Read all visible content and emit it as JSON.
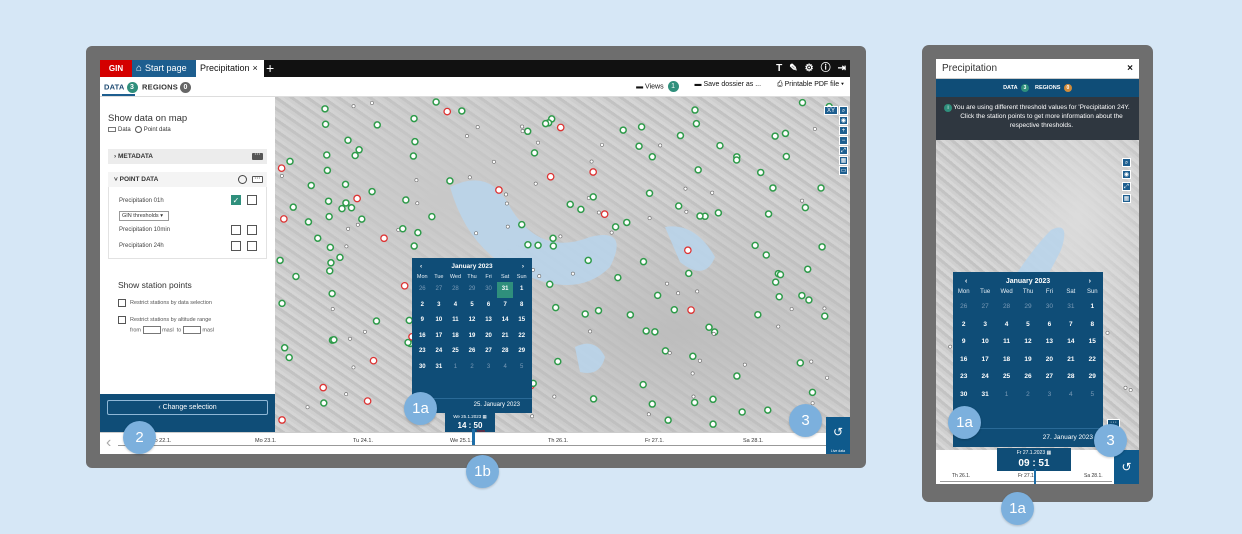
{
  "desktop": {
    "logo": "GIN",
    "tabs": {
      "start": "Start page",
      "precipitation": "Precipitation",
      "close": "×",
      "add": "+"
    },
    "toolbar_icons": [
      "text-icon",
      "wrench-icon",
      "gear-icon",
      "help-icon",
      "logout-icon"
    ],
    "toolbar_glyphs": {
      "text": "T",
      "wrench": "🔧",
      "gear": "⚙",
      "help": "?",
      "logout": "⏻"
    },
    "subtabs": {
      "data": "DATA",
      "data_count": "3",
      "regions": "REGIONS",
      "regions_count": "0"
    },
    "actions": {
      "views": "Views",
      "views_count": "1",
      "save": "Save dossier as ...",
      "pdf": "Printable PDF file"
    },
    "panel": {
      "title": "Show data on map",
      "opt_data": "Data",
      "opt_point": "Point data",
      "metadata": "METADATA",
      "point_data": "POINT DATA",
      "rows": [
        "Precipitation 01h",
        "Precipitation 10min",
        "Precipitation 24h"
      ],
      "threshold_select": "GIN thresholds",
      "show_stations": "Show station points",
      "restrict_selection": "Restrict stations by data selection",
      "restrict_altitude": "Restrict stations by altitude range",
      "from": "from",
      "masl1": "masl",
      "to": "to",
      "masl2": "masl",
      "change_button": "‹ Change selection"
    },
    "calendar": {
      "month": "January 2023",
      "dow": [
        "Mon",
        "Tue",
        "Wed",
        "Thu",
        "Fri",
        "Sat",
        "Sun"
      ],
      "days": [
        "26",
        "27",
        "28",
        "29",
        "30",
        "31",
        "1",
        "2",
        "3",
        "4",
        "5",
        "6",
        "7",
        "8",
        "9",
        "10",
        "11",
        "12",
        "13",
        "14",
        "15",
        "16",
        "17",
        "18",
        "19",
        "20",
        "21",
        "22",
        "23",
        "24",
        "25",
        "26",
        "27",
        "28",
        "29",
        "30",
        "31",
        "1",
        "2",
        "3",
        "4",
        "5"
      ],
      "selected_index": 5,
      "footer": "25. January 2023",
      "datetime": "We 25.1.2023",
      "time": "14 : 50",
      "now": "Now"
    },
    "timeline": {
      "labels": [
        "Mo 22.1.",
        "Mo 23.1.",
        "Tu 24.1.",
        "We 25.1.",
        "Th 26.1.",
        "Fr 27.1.",
        "Sa 28.1."
      ],
      "history_caption": "Live data"
    },
    "map_controls": [
      "XY",
      "🔍",
      "⦿",
      "+",
      "−",
      "⤡",
      "▦",
      "▭"
    ]
  },
  "callouts": {
    "c2": "2",
    "c1a": "1a",
    "c1b": "1b",
    "c3": "3",
    "m1a": "1a",
    "m3": "3",
    "m1a_bottom": "1a"
  },
  "mobile": {
    "title": "Precipitation",
    "close": "×",
    "tabs": {
      "data": "DATA",
      "data_count": "3",
      "regions": "REGIONS",
      "regions_count": "0"
    },
    "info": "You are using different threshold values for 'Precipitation 24Y. Click the station points to get more information about the respective thresholds.",
    "calendar": {
      "month": "January 2023",
      "dow": [
        "Mon",
        "Tue",
        "Wed",
        "Thu",
        "Fri",
        "Sat",
        "Sun"
      ],
      "days": [
        "26",
        "27",
        "28",
        "29",
        "30",
        "31",
        "1",
        "2",
        "3",
        "4",
        "5",
        "6",
        "7",
        "8",
        "9",
        "10",
        "11",
        "12",
        "13",
        "14",
        "15",
        "16",
        "17",
        "18",
        "19",
        "20",
        "21",
        "22",
        "23",
        "24",
        "25",
        "26",
        "27",
        "28",
        "29",
        "30",
        "31",
        "1",
        "2",
        "3",
        "4",
        "5"
      ],
      "footer": "27. January 2023",
      "datetime": "Fr 27.1.2023",
      "time": "09 : 51",
      "now": "Now"
    },
    "timeline": {
      "labels": [
        "Th 26.1.",
        "Fr 27.1.",
        "Sa 28.1."
      ]
    }
  },
  "colors": {
    "navy": "#0f4d77",
    "teal": "#2f8f7c",
    "red": "#d40000",
    "bg": "#d6e7f6",
    "callout": "#7cb0dd"
  }
}
